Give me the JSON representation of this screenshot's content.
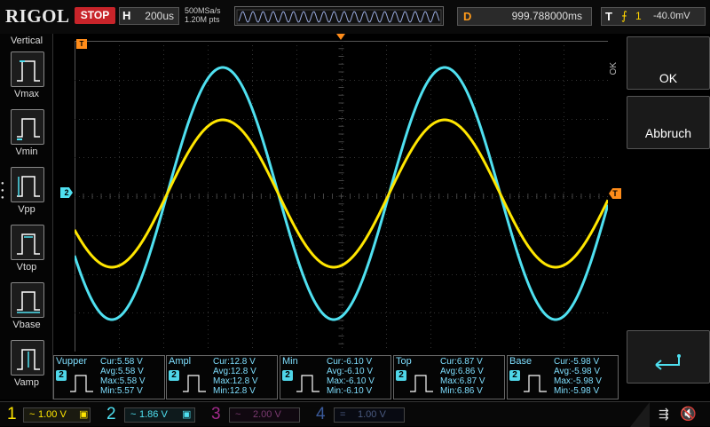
{
  "header": {
    "logo": "RIGOL",
    "run_state": "STOP",
    "timebase_label": "H",
    "timebase_value": "200us",
    "sample_rate": "500MSa/s",
    "memory_depth": "1.20M pts",
    "delay_label": "D",
    "delay_value": "999.788000ms",
    "trigger_label": "T",
    "trigger_slope": "⨍",
    "trigger_source": "1",
    "trigger_level": "-40.0mV"
  },
  "left_menu": {
    "title": "Vertical",
    "items": [
      {
        "label": "Vmax"
      },
      {
        "label": "Vmin"
      },
      {
        "label": "Vpp"
      },
      {
        "label": "Vtop"
      },
      {
        "label": "Vbase"
      },
      {
        "label": "Vamp"
      }
    ]
  },
  "right_menu": {
    "side_label": "OK",
    "ok_label": "OK",
    "cancel_label": "Abbruch"
  },
  "markers": {
    "ch2_ground": "2",
    "trigger_level_marker": "T",
    "trigger_pos_marker": "T"
  },
  "measurements": [
    {
      "name": "Vupper",
      "channel": "2",
      "cur": "Cur:5.58 V",
      "avg": "Avg:5.58 V",
      "max": "Max:5.58 V",
      "min": "Min:5.57 V"
    },
    {
      "name": "Ampl",
      "channel": "2",
      "cur": "Cur:12.8 V",
      "avg": "Avg:12.8 V",
      "max": "Max:12.8 V",
      "min": "Min:12.8 V"
    },
    {
      "name": "Min",
      "channel": "2",
      "cur": "Cur:-6.10 V",
      "avg": "Avg:-6.10 V",
      "max": "Max:-6.10 V",
      "min": "Min:-6.10 V"
    },
    {
      "name": "Top",
      "channel": "2",
      "cur": "Cur:6.87 V",
      "avg": "Avg:6.86 V",
      "max": "Max:6.87 V",
      "min": "Min:6.86 V"
    },
    {
      "name": "Base",
      "channel": "2",
      "cur": "Cur:-5.98 V",
      "avg": "Avg:-5.98 V",
      "max": "Max:-5.98 V",
      "min": "Min:-5.98 V"
    }
  ],
  "channels": [
    {
      "num": "1",
      "scale": "1.00 V",
      "color": "#ffe600"
    },
    {
      "num": "2",
      "scale": "1.86 V",
      "color": "#4fe0f0"
    },
    {
      "num": "3",
      "scale": "2.00 V",
      "color": "#a02a8a"
    },
    {
      "num": "4",
      "scale": "1.00 V",
      "color": "#3a5a9a"
    }
  ],
  "colors": {
    "ch1": "#ffe600",
    "ch2": "#4fe0f0",
    "trigger": "#ff8c1a",
    "stop": "#c8242a"
  }
}
